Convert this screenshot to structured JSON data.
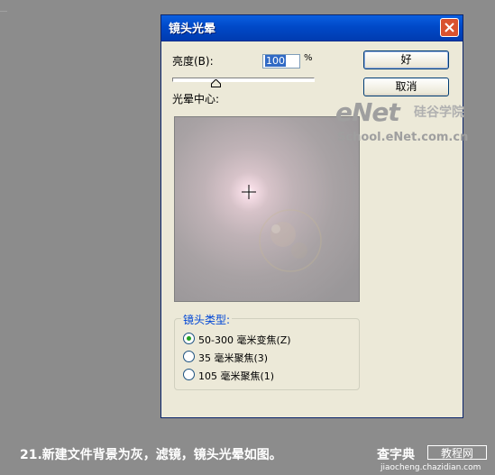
{
  "dialog": {
    "title": "镜头光晕",
    "brightness_label": "亮度(B):",
    "brightness_value": "100",
    "brightness_unit": "%",
    "brightness_slider_fraction": 0.5,
    "flare_center_label": "光晕中心:",
    "ok_label": "好",
    "cancel_label": "取消",
    "lens_type_title": "镜头类型:",
    "lens_options": [
      {
        "label": "50-300 毫米变焦(Z)",
        "selected": true
      },
      {
        "label": "35 毫米聚焦(3)",
        "selected": false
      },
      {
        "label": "105 毫米聚焦(1)",
        "selected": false
      }
    ]
  },
  "watermark": {
    "logo": "eNet",
    "logo_cn": "硅谷学院",
    "url": "School.eNet.com.cn"
  },
  "caption": {
    "text": "21.新建文件背景为灰，滤镜，镜头光晕如图。",
    "site_name": "查字典",
    "site_box": "教程网",
    "site_url": "jiaocheng.chazidian.com"
  }
}
